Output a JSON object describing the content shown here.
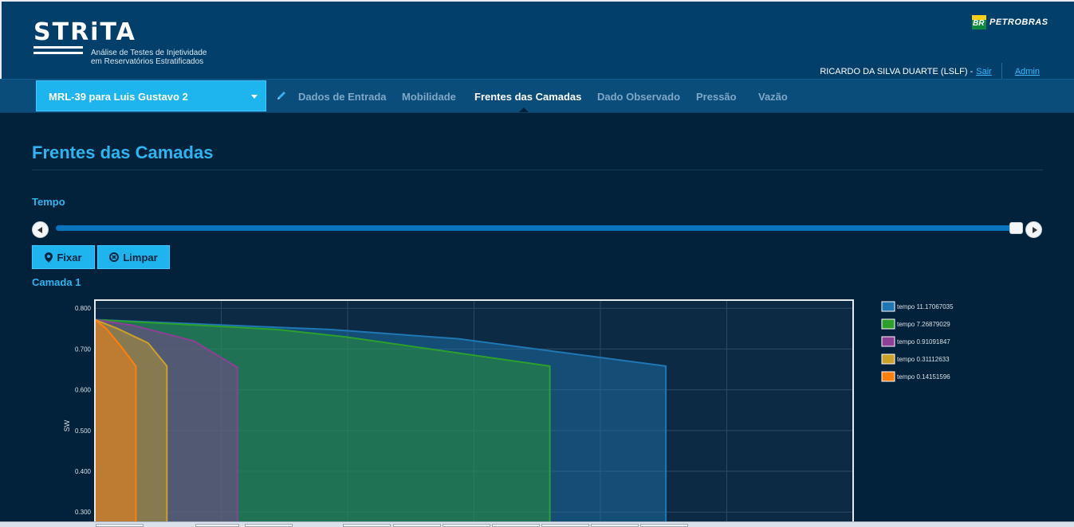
{
  "app": {
    "name": "STRiTA",
    "subtitle_line1": "Análise de Testes de Injetividade",
    "subtitle_line2": "em Reservatórios Estratificados",
    "partner": "PETROBRAS",
    "partner_badge": "BR"
  },
  "user": {
    "name": "RICARDO DA SILVA DUARTE (LSLF) -",
    "logout_label": "Sair",
    "admin_label": "Admin"
  },
  "nav": {
    "project": "MRL-39 para Luis Gustavo 2",
    "items": [
      {
        "label": "Dados de Entrada",
        "active": false
      },
      {
        "label": "Mobilidade",
        "active": false
      },
      {
        "label": "Frentes das Camadas",
        "active": true
      },
      {
        "label": "Dado Observado",
        "active": false
      },
      {
        "label": "Pressão",
        "active": false
      },
      {
        "label": "Vazão",
        "active": false
      }
    ]
  },
  "main": {
    "title": "Frentes das Camadas",
    "tempo_label": "Tempo",
    "slider_value": 1.0,
    "fixar_label": "Fixar",
    "limpar_label": "Limpar",
    "layer_label": "Camada 1"
  },
  "chart_data": {
    "type": "area",
    "ylabel": "SW",
    "xlabel": "",
    "ylim": [
      0.275,
      0.82
    ],
    "xlim": [
      0,
      1
    ],
    "yticks": [
      "0.800",
      "0.700",
      "0.600",
      "0.500",
      "0.400",
      "0.300"
    ],
    "grid": true,
    "legend_position": "right",
    "series": [
      {
        "name": "tempo 11.17067035",
        "color": "#1f77b4",
        "x": [
          0,
          0.31,
          0.48,
          0.753,
          0.753,
          0
        ],
        "y": [
          0.772,
          0.748,
          0.725,
          0.658,
          0.275,
          0.275
        ]
      },
      {
        "name": "tempo 7.26879029",
        "color": "#2ca02c",
        "x": [
          0,
          0.24,
          0.33,
          0.6,
          0.6,
          0
        ],
        "y": [
          0.772,
          0.748,
          0.73,
          0.658,
          0.275,
          0.275
        ]
      },
      {
        "name": "tempo 0.91091847",
        "color": "#8e3f96",
        "x": [
          0,
          0.05,
          0.13,
          0.188,
          0.188,
          0
        ],
        "y": [
          0.772,
          0.758,
          0.72,
          0.655,
          0.275,
          0.275
        ]
      },
      {
        "name": "tempo 0.31112633",
        "color": "#c9a227",
        "x": [
          0,
          0.03,
          0.07,
          0.095,
          0.095,
          0
        ],
        "y": [
          0.772,
          0.75,
          0.715,
          0.658,
          0.275,
          0.275
        ]
      },
      {
        "name": "tempo 0.14151596",
        "color": "#ff7f0e",
        "x": [
          0,
          0.015,
          0.035,
          0.054,
          0.054,
          0
        ],
        "y": [
          0.772,
          0.75,
          0.705,
          0.658,
          0.275,
          0.275
        ]
      }
    ]
  },
  "colors": {
    "accent": "#1eb4ee",
    "header_bg": "#02406b",
    "page_bg": "#01223a"
  }
}
